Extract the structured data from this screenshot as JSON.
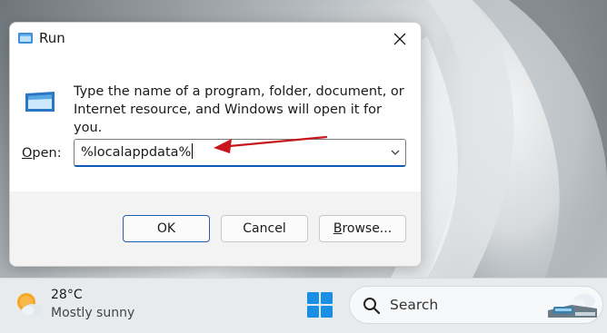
{
  "dialog": {
    "title": "Run",
    "description": "Type the name of a program, folder, document, or Internet resource, and Windows will open it for you.",
    "open_label_underlined": "O",
    "open_label_rest": "pen:",
    "open_value": "%localappdata%",
    "buttons": {
      "ok": "OK",
      "cancel": "Cancel",
      "browse_underlined": "B",
      "browse_rest": "rowse..."
    }
  },
  "taskbar": {
    "weather_temp": "28°C",
    "weather_condition": "Mostly sunny",
    "search_placeholder": "Search"
  },
  "colors": {
    "accent": "#0a5bb5",
    "annotation_arrow": "#c8161d",
    "windows_logo": "#1a8fe3"
  },
  "icons": [
    "run-app-icon",
    "close-icon",
    "chevron-down-icon",
    "annotation-arrow-icon",
    "weather-sun-cloud-icon",
    "windows-start-icon",
    "search-icon",
    "search-highlight-icon"
  ]
}
